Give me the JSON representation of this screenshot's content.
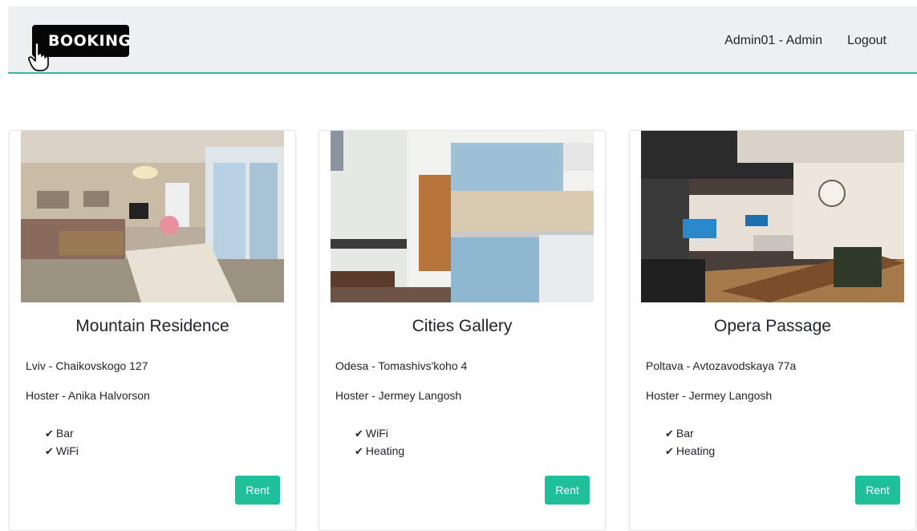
{
  "header": {
    "logo_text": "BOOKING",
    "user_label": "Admin01 - Admin",
    "logout_label": "Logout"
  },
  "cards": [
    {
      "title": "Mountain Residence",
      "address": "Lviv - Chaikovskogo 127",
      "host": "Hoster - Anika Halvorson",
      "amenities": [
        "Bar",
        "WiFi"
      ],
      "button_label": "Rent"
    },
    {
      "title": "Cities Gallery",
      "address": "Odesa - Tomashivs'koho 4",
      "host": "Hoster - Jermey Langosh",
      "amenities": [
        "WiFi",
        "Heating"
      ],
      "button_label": "Rent"
    },
    {
      "title": "Opera Passage",
      "address": "Poltava - Avtozavodskaya 77a",
      "host": "Hoster - Jermey Langosh",
      "amenities": [
        "Bar",
        "Heating"
      ],
      "button_label": "Rent"
    }
  ],
  "icons": {
    "amenity_check": "check-icon",
    "logo_pointer": "pointer-hand-icon"
  },
  "colors": {
    "accent": "#1fbf9a",
    "navbar_bg": "#eef0f1",
    "navbar_border": "#3fb39b"
  }
}
